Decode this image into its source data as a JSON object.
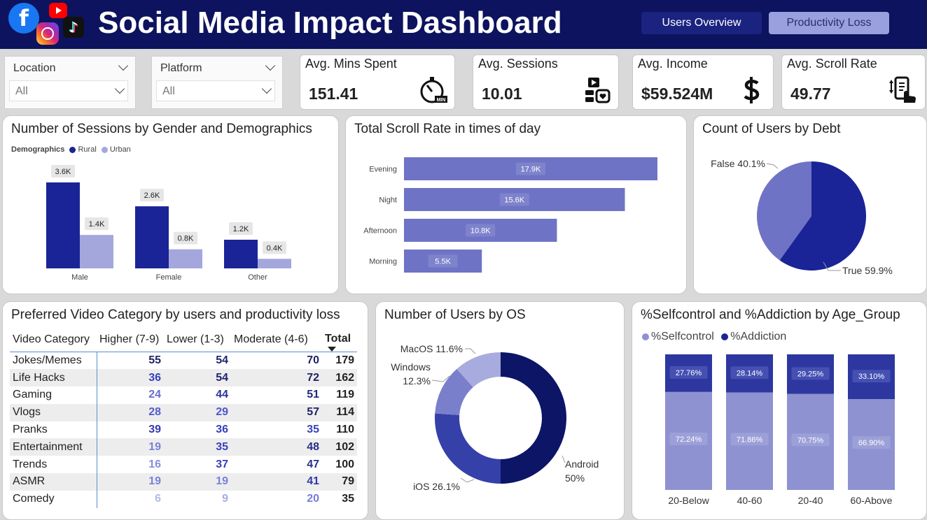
{
  "header": {
    "title": "Social Media Impact Dashboard",
    "nav": {
      "users_overview": "Users Overview",
      "productivity_loss": "Productivity Loss"
    },
    "logos": {
      "facebook": "f",
      "tiktok": "♪"
    }
  },
  "filters": {
    "location": {
      "label": "Location",
      "value": "All"
    },
    "platform": {
      "label": "Platform",
      "value": "All"
    }
  },
  "kpis": {
    "mins": {
      "label": "Avg. Mins Spent",
      "value": "151.41",
      "icon": "stopwatch-icon"
    },
    "sessions": {
      "label": "Avg. Sessions",
      "value": "10.01",
      "icon": "social-apps-icon"
    },
    "income": {
      "label": "Avg. Income",
      "value": "$59.524M",
      "icon": "dollar-icon"
    },
    "scroll": {
      "label": "Avg. Scroll Rate",
      "value": "49.77",
      "icon": "phone-scroll-icon"
    }
  },
  "colors": {
    "dark": "#1a2496",
    "light": "#a3a7dc",
    "mid": "#6e73c5",
    "navy": "#0d135e"
  },
  "chart_data": [
    {
      "type": "bar",
      "title": "Number of Sessions by Gender and Demographics",
      "legend_title": "Demographics",
      "categories": [
        "Male",
        "Female",
        "Other"
      ],
      "series": [
        {
          "name": "Rural",
          "values": [
            3600,
            2600,
            1200
          ],
          "labels": [
            "3.6K",
            "2.6K",
            "1.2K"
          ]
        },
        {
          "name": "Urban",
          "values": [
            1400,
            800,
            400
          ],
          "labels": [
            "1.4K",
            "0.8K",
            "0.4K"
          ]
        }
      ],
      "ylim": [
        0,
        3600
      ]
    },
    {
      "type": "bar",
      "orientation": "horizontal",
      "title": "Total Scroll Rate in times of day",
      "categories": [
        "Evening",
        "Night",
        "Afternoon",
        "Morning"
      ],
      "values": [
        17900,
        15600,
        10800,
        5500
      ],
      "labels": [
        "17.9K",
        "15.6K",
        "10.8K",
        "5.5K"
      ],
      "xlim": [
        0,
        17900
      ]
    },
    {
      "type": "pie",
      "title": "Count of Users by Debt",
      "slices": [
        {
          "name": "True",
          "value": 59.9,
          "label": "True 59.9%"
        },
        {
          "name": "False",
          "value": 40.1,
          "label": "False 40.1%"
        }
      ]
    },
    {
      "type": "table",
      "title": "Preferred Video Category by users and productivity loss",
      "columns": [
        "Video Category",
        "Higher (7-9)",
        "Lower (1-3)",
        "Moderate (4-6)",
        "Total"
      ],
      "rows": [
        [
          "Jokes/Memes",
          55,
          54,
          70,
          179
        ],
        [
          "Life Hacks",
          36,
          54,
          72,
          162
        ],
        [
          "Gaming",
          24,
          44,
          51,
          119
        ],
        [
          "Vlogs",
          28,
          29,
          57,
          114
        ],
        [
          "Pranks",
          39,
          36,
          35,
          110
        ],
        [
          "Entertainment",
          19,
          35,
          48,
          102
        ],
        [
          "Trends",
          16,
          37,
          47,
          100
        ],
        [
          "ASMR",
          19,
          19,
          41,
          79
        ],
        [
          "Comedy",
          6,
          9,
          20,
          35
        ]
      ]
    },
    {
      "type": "pie",
      "variant": "donut",
      "title": "Number of Users by OS",
      "slices": [
        {
          "name": "Android",
          "value": 50,
          "label_lines": [
            "Android",
            "50%"
          ]
        },
        {
          "name": "iOS",
          "value": 26.1,
          "label_lines": [
            "iOS 26.1%"
          ]
        },
        {
          "name": "Windows",
          "value": 12.3,
          "label_lines": [
            "Windows",
            "12.3%"
          ]
        },
        {
          "name": "MacOS",
          "value": 11.6,
          "label_lines": [
            "MacOS 11.6%"
          ]
        }
      ]
    },
    {
      "type": "bar",
      "stacked": "100%",
      "title": "%Selfcontrol and %Addiction by Age_Group",
      "categories": [
        "20-Below",
        "40-60",
        "20-40",
        "60-Above"
      ],
      "series": [
        {
          "name": "%Selfcontrol",
          "values": [
            72.24,
            71.86,
            70.75,
            66.9
          ],
          "labels": [
            "72.24%",
            "71.86%",
            "70.75%",
            "66.90%"
          ]
        },
        {
          "name": "%Addiction",
          "values": [
            27.76,
            28.14,
            29.25,
            33.1
          ],
          "labels": [
            "27.76%",
            "28.14%",
            "29.25%",
            "33.10%"
          ]
        }
      ],
      "ylim": [
        0,
        100
      ]
    }
  ]
}
